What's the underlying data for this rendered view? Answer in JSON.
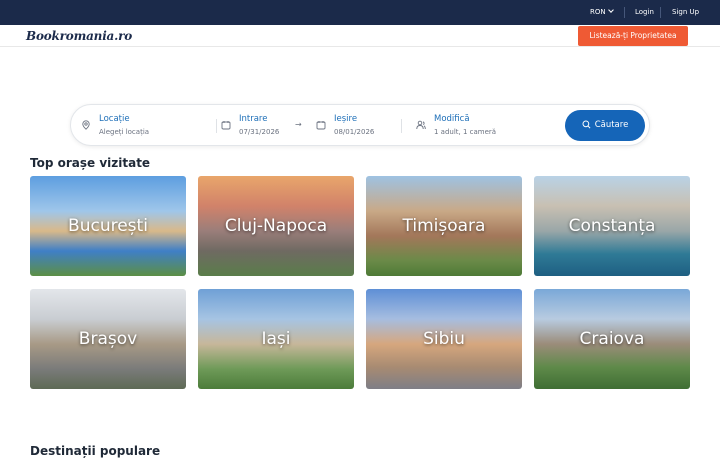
{
  "topbar": {
    "currency": "RON",
    "login": "Login",
    "signup": "Sign Up"
  },
  "header": {
    "logo": "Bookromania.ro",
    "list_property": "Listează-ți Proprietatea"
  },
  "search": {
    "location_label": "Locație",
    "location_placeholder": "Alegeți locația",
    "checkin_label": "Intrare",
    "checkin_value": "07/31/2026",
    "checkout_label": "Ieșire",
    "checkout_value": "08/01/2026",
    "guests_label": "Modifică",
    "guests_value": "1 adult, 1 cameră",
    "button": "Căutare"
  },
  "sections": {
    "top_cities": "Top orașe vizitate",
    "next": "Destinații populare"
  },
  "cities": [
    "București",
    "Cluj-Napoca",
    "Timișoara",
    "Constanța",
    "Brașov",
    "Iași",
    "Sibiu",
    "Craiova"
  ],
  "colors": {
    "topbar": "#1b2a4a",
    "accent_orange": "#ef5a34",
    "accent_blue": "#1565b8",
    "link_blue": "#1e6fb8"
  }
}
